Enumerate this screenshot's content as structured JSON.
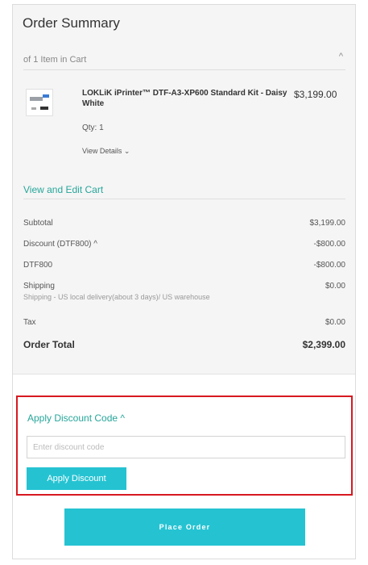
{
  "summary": {
    "title": "Order Summary",
    "items_label": "of 1 Item in Cart",
    "collapse_glyph": "^",
    "item": {
      "name": "LOKLiK iPrinter™ DTF-A3-XP600 Standard Kit - Daisy White",
      "price": "$3,199.00",
      "qty_label": "Qty:",
      "qty_value": "1",
      "details_label": "View Details ⌄"
    },
    "edit_cart": "View and Edit Cart"
  },
  "totals": {
    "subtotal_label": "Subtotal",
    "subtotal_value": "$3,199.00",
    "discount_label": "Discount (DTF800) ^",
    "discount_value": "-$800.00",
    "code_label": "DTF800",
    "code_value": "-$800.00",
    "shipping_label": "Shipping",
    "shipping_value": "$0.00",
    "shipping_method": "Shipping - US local delivery(about 3 days)/ US warehouse",
    "tax_label": "Tax",
    "tax_value": "$0.00",
    "order_total_label": "Order Total",
    "order_total_value": "$2,399.00"
  },
  "discount": {
    "toggle_label": "Apply Discount Code ^",
    "input_value": "",
    "input_placeholder": "Enter discount code",
    "button_label": "Apply Discount"
  },
  "checkout": {
    "place_order_label": "Place Order"
  },
  "colors": {
    "accent": "#25c3d2",
    "link": "#26a69a",
    "highlight_border": "#d71920"
  }
}
